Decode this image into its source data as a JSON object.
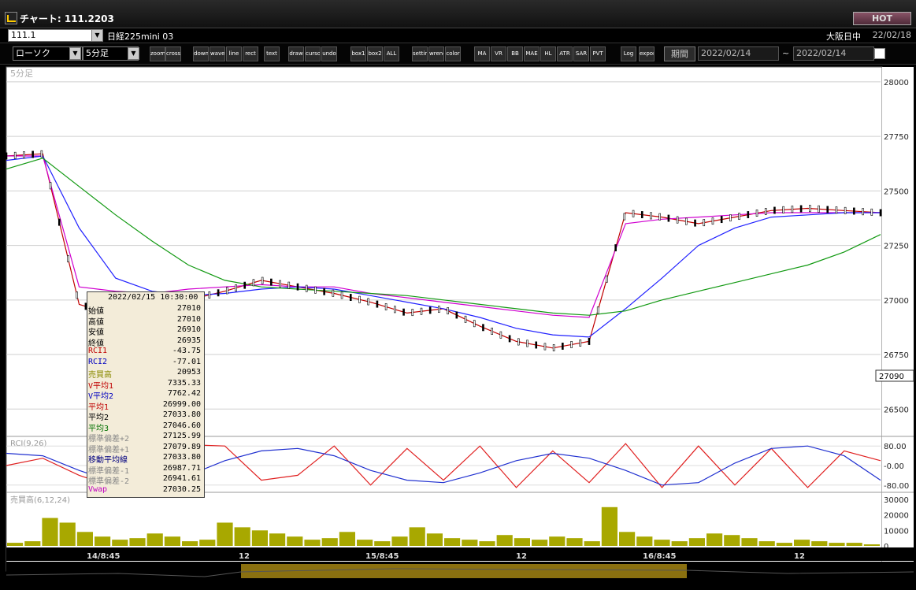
{
  "window": {
    "title": "チャート: 111.2203",
    "hot_label": "HOT"
  },
  "symbol_bar": {
    "code": "111.1",
    "name": "日経225mini 03",
    "exchange": "大阪日中",
    "date": "22/02/18"
  },
  "toolbar": {
    "chart_type": "ローソク",
    "interval": "5分足",
    "buttons": [
      "zoom",
      "crosshair",
      "down",
      "wave",
      "line",
      "rect",
      "text",
      "draw",
      "cursor",
      "undo",
      "box1",
      "box2",
      "ALL",
      "settings",
      "wrench",
      "color",
      "MA",
      "VR",
      "BB",
      "MAE",
      "HL",
      "ATR",
      "SAR",
      "PVT",
      "Log",
      "export"
    ],
    "period_label": "期間",
    "date_from": "2022/02/14",
    "date_to": "2022/02/14",
    "tilde": "~"
  },
  "main_panel": {
    "label": "5分足",
    "price_axis": [
      "28000",
      "27750",
      "27500",
      "27250",
      "27000",
      "26750",
      "26500"
    ],
    "current_price": "27090"
  },
  "rci_panel": {
    "label": "RCI(9,26)",
    "axis": [
      "80.00",
      "-0.00",
      "-80.00"
    ]
  },
  "volume_panel": {
    "label": "売買高(6,12,24)",
    "axis": [
      "30000",
      "20000",
      "10000",
      "0"
    ]
  },
  "time_axis": [
    "14/8:45",
    "12",
    "15/8:45",
    "12",
    "16/8:45",
    "12"
  ],
  "info_box": {
    "date": "2022/02/15  10:30:00",
    "rows": [
      {
        "label": "始値",
        "value": "27010",
        "color": "#000000"
      },
      {
        "label": "高値",
        "value": "27010",
        "color": "#000000"
      },
      {
        "label": "安値",
        "value": "26910",
        "color": "#000000"
      },
      {
        "label": "終値",
        "value": "26935",
        "color": "#000000"
      },
      {
        "label": "RCI1",
        "value": "-43.75",
        "color": "#c00000"
      },
      {
        "label": "RCI2",
        "value": "-77.01",
        "color": "#0000c0"
      },
      {
        "label": "売買高",
        "value": "20953",
        "color": "#8a8a00"
      },
      {
        "label": "V平均1",
        "value": "7335.33",
        "color": "#c00000"
      },
      {
        "label": "V平均2",
        "value": "7762.42",
        "color": "#0000c0"
      },
      {
        "label": "平均1",
        "value": "26999.00",
        "color": "#c00000"
      },
      {
        "label": "平均2",
        "value": "27033.80",
        "color": "#000000"
      },
      {
        "label": "平均3",
        "value": "27046.60",
        "color": "#007000"
      },
      {
        "label": "標準偏差+2",
        "value": "27125.99",
        "color": "#888888"
      },
      {
        "label": "標準偏差+1",
        "value": "27079.89",
        "color": "#888888"
      },
      {
        "label": "移動平均線",
        "value": "27033.80",
        "color": "#000080"
      },
      {
        "label": "標準偏差-1",
        "value": "26987.71",
        "color": "#888888"
      },
      {
        "label": "標準偏差-2",
        "value": "26941.61",
        "color": "#888888"
      },
      {
        "label": "Vwap",
        "value": "27030.25",
        "color": "#c000c0"
      }
    ]
  },
  "chart_data": {
    "type": "line",
    "x_labels": [
      "14/8:45",
      "12",
      "15/8:45",
      "12",
      "16/8:45",
      "12"
    ],
    "ylim": [
      26400,
      28050
    ],
    "series": [
      {
        "values": [
          27660,
          27670,
          26980,
          26930,
          26935,
          27000,
          27040,
          27090,
          27060,
          27030,
          26990,
          26940,
          26960,
          26880,
          26810,
          26780,
          26810,
          27400,
          27380,
          27350,
          27380,
          27410,
          27420,
          27410,
          27400
        ]
      },
      {
        "values": [
          27660,
          27660,
          27060,
          27040,
          27030,
          27050,
          27060,
          27070,
          27060,
          27060,
          27030,
          27010,
          26990,
          26970,
          26950,
          26930,
          26920,
          27350,
          27370,
          27380,
          27390,
          27400,
          27400,
          27400,
          27400
        ]
      },
      {
        "values": [
          27640,
          27660,
          27330,
          27100,
          27040,
          27020,
          27030,
          27050,
          27060,
          27050,
          27020,
          26990,
          26960,
          26920,
          26870,
          26840,
          26830,
          26960,
          27100,
          27250,
          27330,
          27380,
          27390,
          27400,
          27400
        ]
      },
      {
        "values": [
          27600,
          27650,
          27520,
          27390,
          27270,
          27160,
          27090,
          27060,
          27050,
          27040,
          27030,
          27020,
          27000,
          26980,
          26960,
          26940,
          26930,
          26950,
          27000,
          27040,
          27080,
          27120,
          27160,
          27220,
          27300
        ]
      }
    ],
    "colors": [
      "#c00000",
      "#d000d0",
      "#2020ff",
      "#119911"
    ],
    "rci": {
      "ylim": [
        -100,
        100
      ],
      "series": [
        {
          "color": "#e02020",
          "values": [
            0,
            30,
            -40,
            -90,
            -20,
            85,
            80,
            -60,
            -40,
            80,
            -80,
            70,
            -60,
            80,
            -90,
            60,
            -70,
            90,
            -90,
            80,
            -80,
            70,
            -90,
            60,
            20
          ]
        },
        {
          "color": "#2030d0",
          "values": [
            50,
            40,
            -20,
            -70,
            -90,
            -40,
            20,
            60,
            70,
            40,
            -20,
            -60,
            -70,
            -30,
            20,
            50,
            30,
            -20,
            -80,
            -70,
            10,
            70,
            80,
            40,
            -60
          ]
        }
      ]
    },
    "volume": {
      "ylim": [
        0,
        32000
      ],
      "values": [
        2000,
        3000,
        18000,
        15000,
        9000,
        6000,
        4000,
        5000,
        8000,
        6000,
        3000,
        4000,
        15000,
        12000,
        10000,
        8000,
        6000,
        4000,
        5000,
        9000,
        4000,
        3000,
        6000,
        12000,
        8000,
        5000,
        4000,
        3000,
        7000,
        5000,
        4000,
        6000,
        5000,
        3000,
        25000,
        9000,
        6000,
        4000,
        3000,
        5000,
        8000,
        7000,
        5000,
        3000,
        2000,
        4000,
        3000,
        2000,
        2000,
        1000
      ]
    }
  }
}
